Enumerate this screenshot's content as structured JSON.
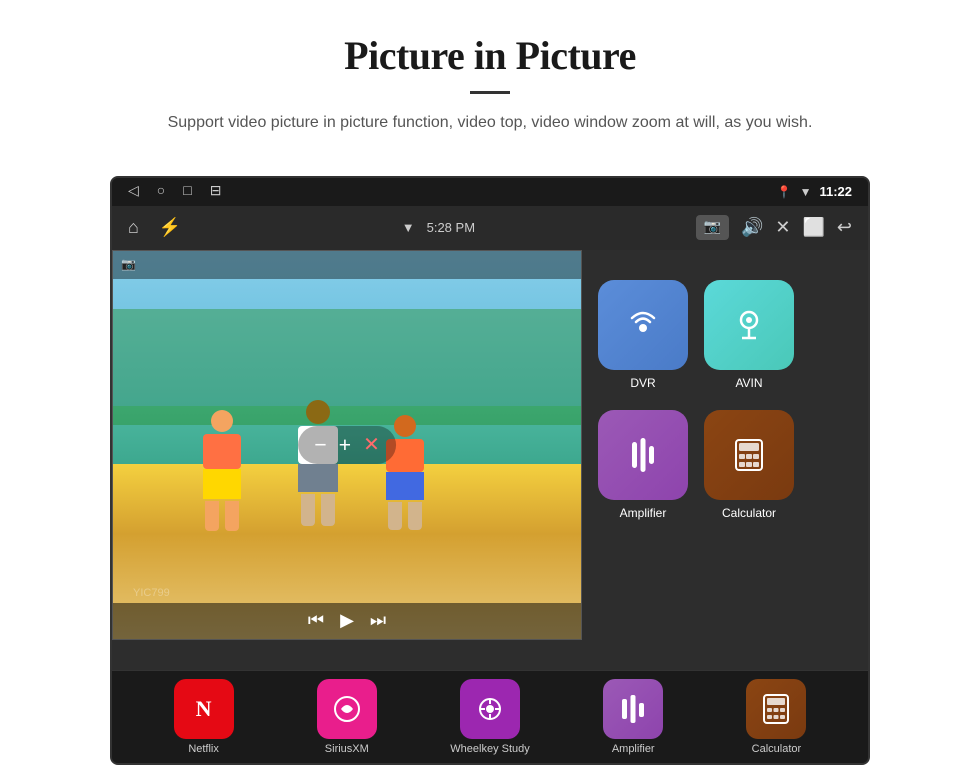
{
  "header": {
    "title": "Picture in Picture",
    "subtitle": "Support video picture in picture function, video top, video window zoom at will, as you wish."
  },
  "status_bar": {
    "time": "11:22",
    "app_time": "5:28 PM"
  },
  "app_icons": [
    {
      "id": "dvr",
      "label": "DVR",
      "color": "#5b8dd9",
      "icon": "📡"
    },
    {
      "id": "avin",
      "label": "AVIN",
      "color": "#5bd9d9",
      "icon": "🔌"
    },
    {
      "id": "amplifier",
      "label": "Amplifier",
      "color": "#9b59b6",
      "icon": "🎚"
    },
    {
      "id": "calculator",
      "label": "Calculator",
      "color": "#8B4513",
      "icon": "🧮"
    }
  ],
  "bottom_apps": [
    {
      "id": "netflix",
      "label": "Netflix"
    },
    {
      "id": "siriusxm",
      "label": "SiriusXM"
    },
    {
      "id": "wheelkey",
      "label": "Wheelkey Study"
    },
    {
      "id": "amplifier",
      "label": "Amplifier"
    },
    {
      "id": "calculator",
      "label": "Calculator"
    }
  ],
  "pip_controls": {
    "minus": "−",
    "plus": "+",
    "close": "✕",
    "rewind": "⏮",
    "play": "▶",
    "forward": "⏭"
  }
}
